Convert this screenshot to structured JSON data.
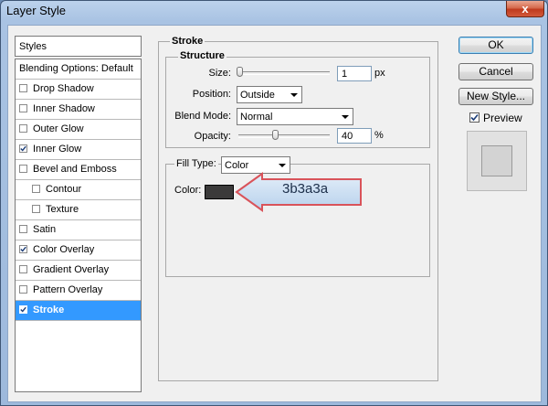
{
  "window": {
    "title": "Layer Style",
    "close_label": "x"
  },
  "left_panel": {
    "styles_header": "Styles",
    "items": [
      {
        "label": "Blending Options: Default",
        "checkbox": false,
        "checked": false
      },
      {
        "label": "Drop Shadow",
        "checkbox": true,
        "checked": false
      },
      {
        "label": "Inner Shadow",
        "checkbox": true,
        "checked": false
      },
      {
        "label": "Outer Glow",
        "checkbox": true,
        "checked": false
      },
      {
        "label": "Inner Glow",
        "checkbox": true,
        "checked": true
      },
      {
        "label": "Bevel and Emboss",
        "checkbox": true,
        "checked": false
      },
      {
        "label": "Contour",
        "checkbox": true,
        "checked": false
      },
      {
        "label": "Texture",
        "checkbox": true,
        "checked": false
      },
      {
        "label": "Satin",
        "checkbox": true,
        "checked": false
      },
      {
        "label": "Color Overlay",
        "checkbox": true,
        "checked": true
      },
      {
        "label": "Gradient Overlay",
        "checkbox": true,
        "checked": false
      },
      {
        "label": "Pattern Overlay",
        "checkbox": true,
        "checked": false
      },
      {
        "label": "Stroke",
        "checkbox": true,
        "checked": true,
        "selected": true
      }
    ]
  },
  "stroke": {
    "section_title": "Stroke",
    "structure_title": "Structure",
    "size_label": "Size:",
    "size_value": "1",
    "size_unit": "px",
    "size_slider_fraction": 0.01,
    "position_label": "Position:",
    "position_value": "Outside",
    "blend_mode_label": "Blend Mode:",
    "blend_mode_value": "Normal",
    "opacity_label": "Opacity:",
    "opacity_value": "40",
    "opacity_unit": "%",
    "opacity_slider_fraction": 0.4,
    "fill_type_label": "Fill Type:",
    "fill_type_value": "Color",
    "color_label": "Color:",
    "color_hex": "#3b3a3a"
  },
  "callout": {
    "text": "3b3a3a"
  },
  "buttons": {
    "ok": "OK",
    "cancel": "Cancel",
    "new_style": "New Style...",
    "preview_label": "Preview",
    "preview_checked": true
  },
  "colors": {
    "selection": "#3399ff",
    "callout_border": "#d9535a",
    "callout_fill": "#c5dcf2"
  }
}
